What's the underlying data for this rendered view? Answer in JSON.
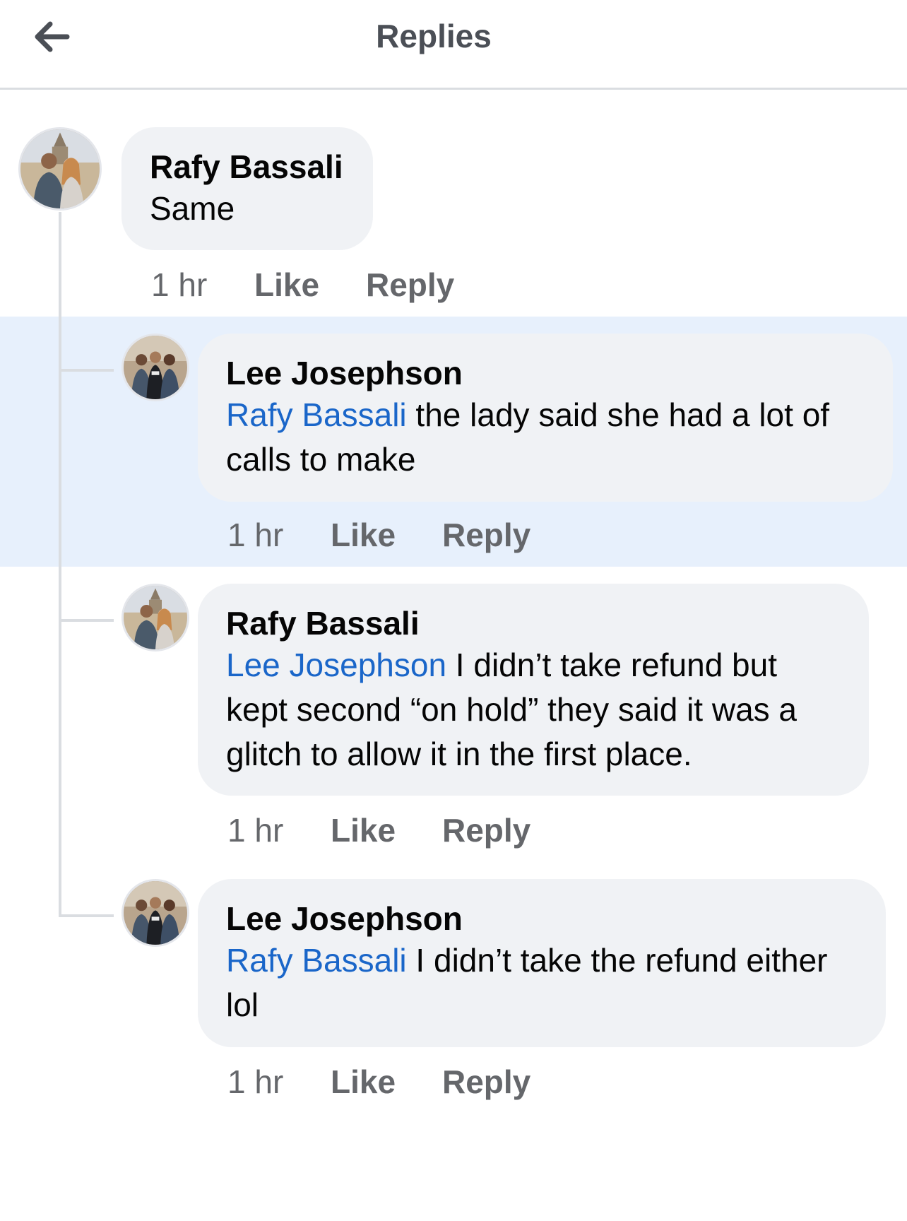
{
  "header": {
    "title": "Replies",
    "back_icon": "arrow-left-icon"
  },
  "comments": [
    {
      "author": "Rafy Bassali",
      "mention": "",
      "text": "Same",
      "time": "1 hr",
      "like_label": "Like",
      "reply_label": "Reply",
      "highlighted": false
    },
    {
      "author": "Lee Josephson",
      "mention": "Rafy Bassali",
      "text": " the lady said she had a lot of calls to make",
      "time": "1 hr",
      "like_label": "Like",
      "reply_label": "Reply",
      "highlighted": true
    },
    {
      "author": "Rafy Bassali",
      "mention": "Lee Josephson",
      "text": " I didn’t take refund but kept second “on hold” they said it was a glitch to allow it in the first place.",
      "time": "1 hr",
      "like_label": "Like",
      "reply_label": "Reply",
      "highlighted": false
    },
    {
      "author": "Lee Josephson",
      "mention": "Rafy Bassali",
      "text": " I didn’t take the refund either lol",
      "time": "1 hr",
      "like_label": "Like",
      "reply_label": "Reply",
      "highlighted": false
    }
  ],
  "colors": {
    "mention": "#1a66c9",
    "bubble": "#f0f2f5",
    "highlight": "#e7f0fc",
    "meta": "#65676b"
  }
}
